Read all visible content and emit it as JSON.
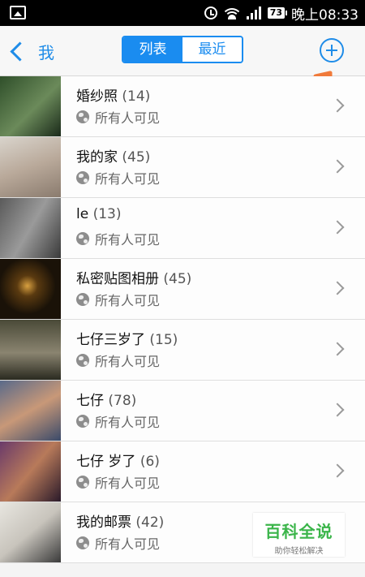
{
  "status_bar": {
    "battery": "73",
    "time": "晚上08:33"
  },
  "nav": {
    "back_label": "我",
    "tabs": [
      {
        "label": "列表",
        "active": true
      },
      {
        "label": "最近",
        "active": false
      }
    ],
    "add_icon": "plus-circle-icon"
  },
  "albums": [
    {
      "title": "婚纱照",
      "count": "(14)",
      "privacy": "所有人可见",
      "thumb_colors": [
        "#2f4f2a",
        "#6b8a5a",
        "#1a2a1a"
      ]
    },
    {
      "title": "我的家",
      "count": "(45)",
      "privacy": "所有人可见",
      "thumb_colors": [
        "#d9d4cc",
        "#b9a99a",
        "#8a7b6e"
      ]
    },
    {
      "title": "le",
      "count": "(13)",
      "privacy": "所有人可见",
      "thumb_colors": [
        "#5a5a5a",
        "#9a9a9a",
        "#3a3a3a"
      ]
    },
    {
      "title": "私密贴图相册",
      "count": "(45)",
      "privacy": "所有人可见",
      "thumb_colors": [
        "#1a1208",
        "#5a3a10",
        "#d8a040"
      ]
    },
    {
      "title": "七仔三岁了",
      "count": "(15)",
      "privacy": "所有人可见",
      "thumb_colors": [
        "#4a4a38",
        "#8a8470",
        "#2a2a20"
      ]
    },
    {
      "title": "七仔",
      "count": "(78)",
      "privacy": "所有人可见",
      "thumb_colors": [
        "#5a6a8a",
        "#c89878",
        "#3a4a6a"
      ]
    },
    {
      "title": "七仔   岁了",
      "count": "(6)",
      "privacy": "所有人可见",
      "thumb_colors": [
        "#6a3a6a",
        "#b87a5a",
        "#2a1a2a"
      ]
    },
    {
      "title": "我的邮票",
      "count": "(42)",
      "privacy": "所有人可见",
      "thumb_colors": [
        "#e8e6e0",
        "#c8c4bc",
        "#3a3a3a"
      ]
    }
  ],
  "watermark": {
    "main": "百科全说",
    "sub": "助你轻松解决"
  },
  "colors": {
    "accent": "#1a8cf0",
    "annotation_arrow": "#f07a3a"
  }
}
